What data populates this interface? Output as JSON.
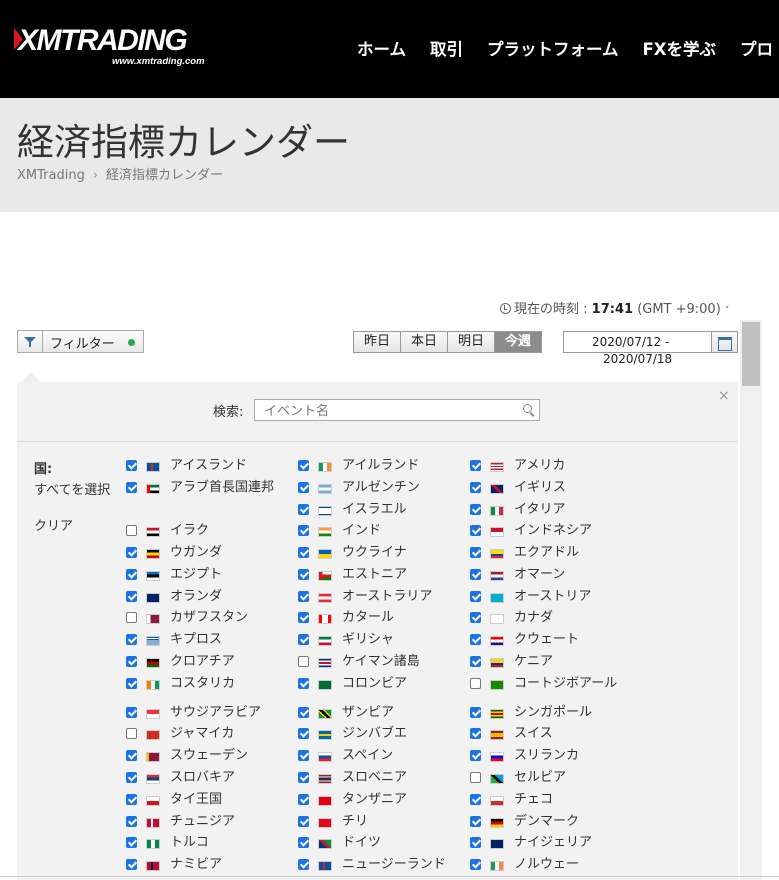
{
  "header": {
    "logo_text": "XMTRADING",
    "logo_url": "www.xmtrading.com",
    "nav": [
      "ホーム",
      "取引",
      "プラットフォーム",
      "FXを学ぶ",
      "プロ"
    ]
  },
  "page": {
    "title": "経済指標カレンダー",
    "breadcrumb": [
      "XMTrading",
      "経済指標カレンダー"
    ]
  },
  "time": {
    "label": "現在の時刻 :",
    "value": "17:41",
    "zone": "(GMT +9:00)"
  },
  "toolbar": {
    "filter_label": "フィルター",
    "periods": [
      "昨日",
      "本日",
      "明日",
      "今週"
    ],
    "active_period": "今週",
    "date_from": "2020/07/12 -",
    "date_to": "2020/07/18"
  },
  "filter_panel": {
    "search_label": "検索:",
    "search_placeholder": "イベント名",
    "close": "×",
    "country_label": "国:",
    "select_all": "すべてを選択",
    "clear": "クリア",
    "colors": {
      "checkbox": "#1a73e8",
      "active_dot": "#2ea84a",
      "accent": "#d51920"
    },
    "countries": [
      [
        {
          "name": "アイスランド",
          "checked": true
        },
        {
          "name": "アイルランド",
          "checked": true
        },
        {
          "name": "アメリカ",
          "checked": true
        }
      ],
      [
        {
          "name": "アラブ首長国連邦",
          "checked": true
        },
        {
          "name": "アルゼンチン",
          "checked": true
        },
        {
          "name": "イギリス",
          "checked": true
        }
      ],
      [
        null,
        {
          "name": "イスラエル",
          "checked": true
        },
        {
          "name": "イタリア",
          "checked": true
        }
      ],
      [
        {
          "name": "イラク",
          "checked": false
        },
        {
          "name": "インド",
          "checked": true
        },
        {
          "name": "インドネシア",
          "checked": true
        }
      ],
      [
        {
          "name": "ウガンダ",
          "checked": true
        },
        {
          "name": "ウクライナ",
          "checked": true
        },
        {
          "name": "エクアドル",
          "checked": true
        }
      ],
      [
        {
          "name": "エジプト",
          "checked": true
        },
        {
          "name": "エストニア",
          "checked": true
        },
        {
          "name": "オマーン",
          "checked": true
        }
      ],
      [
        {
          "name": "オランダ",
          "checked": true
        },
        {
          "name": "オーストラリア",
          "checked": true
        },
        {
          "name": "オーストリア",
          "checked": true
        }
      ],
      [
        {
          "name": "カザフスタン",
          "checked": false
        },
        {
          "name": "カタール",
          "checked": true
        },
        {
          "name": "カナダ",
          "checked": true
        }
      ],
      [
        {
          "name": "キプロス",
          "checked": true
        },
        {
          "name": "ギリシャ",
          "checked": true
        },
        {
          "name": "クウェート",
          "checked": true
        }
      ],
      [
        {
          "name": "クロアチア",
          "checked": true
        },
        {
          "name": "ケイマン諸島",
          "checked": false
        },
        {
          "name": "ケニア",
          "checked": true
        }
      ],
      [
        {
          "name": "コスタリカ",
          "checked": true
        },
        {
          "name": "コロンビア",
          "checked": true
        },
        {
          "name": "コートジボアール",
          "checked": false
        }
      ],
      [
        {
          "name": "サウジアラビア",
          "checked": true
        },
        {
          "name": "ザンビア",
          "checked": true
        },
        {
          "name": "シンガポール",
          "checked": true
        }
      ],
      [
        {
          "name": "ジャマイカ",
          "checked": false
        },
        {
          "name": "ジンバブエ",
          "checked": true
        },
        {
          "name": "スイス",
          "checked": true
        }
      ],
      [
        {
          "name": "スウェーデン",
          "checked": true
        },
        {
          "name": "スペイン",
          "checked": true
        },
        {
          "name": "スリランカ",
          "checked": true
        }
      ],
      [
        {
          "name": "スロバキア",
          "checked": true
        },
        {
          "name": "スロベニア",
          "checked": true
        },
        {
          "name": "セルビア",
          "checked": false
        }
      ],
      [
        {
          "name": "タイ王国",
          "checked": true
        },
        {
          "name": "タンザニア",
          "checked": true
        },
        {
          "name": "チェコ",
          "checked": true
        }
      ],
      [
        {
          "name": "チュニジア",
          "checked": true
        },
        {
          "name": "チリ",
          "checked": true
        },
        {
          "name": "デンマーク",
          "checked": true
        }
      ],
      [
        {
          "name": "トルコ",
          "checked": true
        },
        {
          "name": "ドイツ",
          "checked": true
        },
        {
          "name": "ナイジェリア",
          "checked": true
        }
      ],
      [
        {
          "name": "ナミビア",
          "checked": true
        },
        {
          "name": "ニュージーランド",
          "checked": true
        },
        {
          "name": "ノルウェー",
          "checked": true
        }
      ]
    ]
  }
}
